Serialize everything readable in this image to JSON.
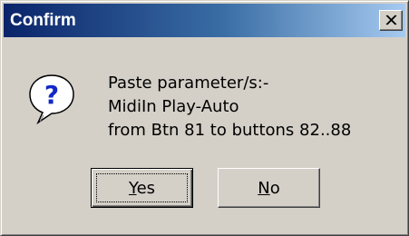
{
  "dialog": {
    "title": "Confirm",
    "close_icon": "close-icon",
    "icon": "question-icon",
    "message_lines": [
      "Paste parameter/s:-",
      "MidiIn Play-Auto",
      "from Btn 81 to buttons 82..88"
    ],
    "buttons": {
      "yes": {
        "mnemonic": "Y",
        "rest": "es",
        "label": "Yes"
      },
      "no": {
        "mnemonic": "N",
        "rest": "o",
        "label": "No"
      }
    },
    "colors": {
      "title_gradient_start": "#0a246a",
      "title_gradient_end": "#a6caf0",
      "face": "#d4d0c8",
      "icon_blue": "#1428c8"
    }
  }
}
